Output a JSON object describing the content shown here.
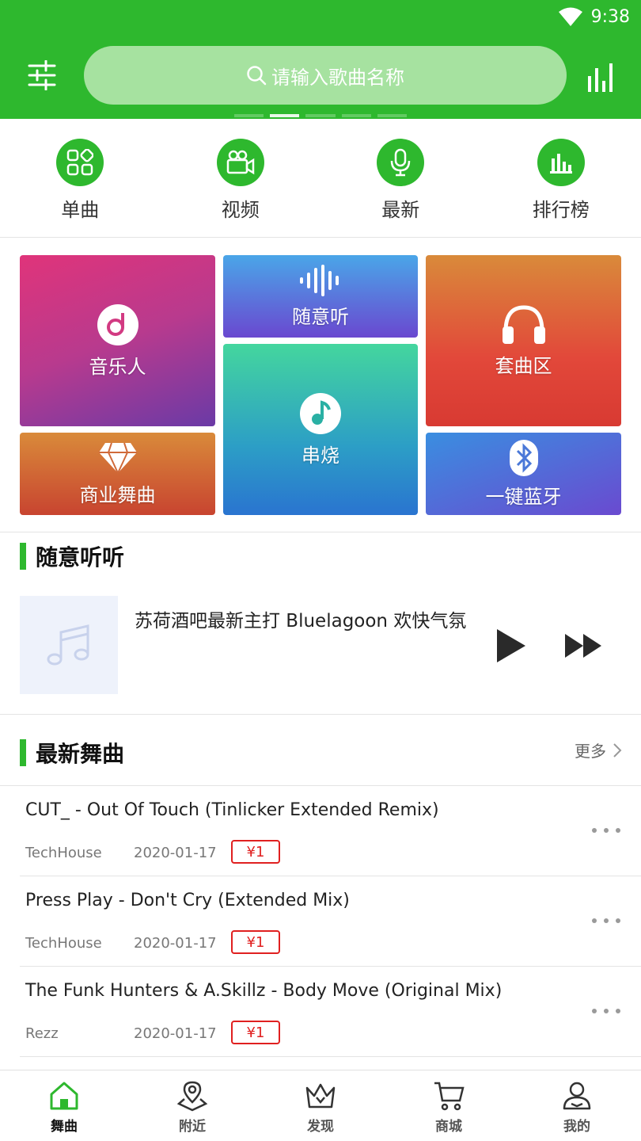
{
  "status": {
    "time": "9:38"
  },
  "search": {
    "placeholder": "请输入歌曲名称"
  },
  "categories": [
    {
      "label": "单曲",
      "icon": "grid-icon"
    },
    {
      "label": "视频",
      "icon": "video-camera-icon"
    },
    {
      "label": "最新",
      "icon": "microphone-icon"
    },
    {
      "label": "排行榜",
      "icon": "bar-chart-icon"
    }
  ],
  "tiles": [
    {
      "label": "音乐人",
      "icon": "music-disc-icon"
    },
    {
      "label": "随意听",
      "icon": "waveform-icon"
    },
    {
      "label": "套曲区",
      "icon": "headphones-icon"
    },
    {
      "label": "商业舞曲",
      "icon": "diamond-icon"
    },
    {
      "label": "串烧",
      "icon": "music-note-icon"
    },
    {
      "label": "一键蓝牙",
      "icon": "bluetooth-icon"
    }
  ],
  "random": {
    "section_title": "随意听听",
    "track_title": "苏荷酒吧最新主打 Bluelagoon 欢快气氛"
  },
  "latest": {
    "section_title": "最新舞曲",
    "more_label": "更多",
    "tracks": [
      {
        "title": "CUT_ - Out Of Touch (Tinlicker Extended Remix)",
        "genre": "TechHouse",
        "date": "2020-01-17",
        "price": "¥1"
      },
      {
        "title": "Press Play - Don't Cry (Extended Mix)",
        "genre": "TechHouse",
        "date": "2020-01-17",
        "price": "¥1"
      },
      {
        "title": "The Funk Hunters & A.Skillz - Body Move (Original Mix)",
        "genre": "Rezz",
        "date": "2020-01-17",
        "price": "¥1"
      }
    ]
  },
  "bottom_nav": [
    {
      "label": "舞曲",
      "icon": "home-icon",
      "active": true
    },
    {
      "label": "附近",
      "icon": "location-map-icon",
      "active": false
    },
    {
      "label": "发现",
      "icon": "crown-icon",
      "active": false
    },
    {
      "label": "商城",
      "icon": "cart-icon",
      "active": false
    },
    {
      "label": "我的",
      "icon": "user-icon",
      "active": false
    }
  ],
  "colors": {
    "brand": "#2eb82e",
    "price": "#e02020"
  }
}
